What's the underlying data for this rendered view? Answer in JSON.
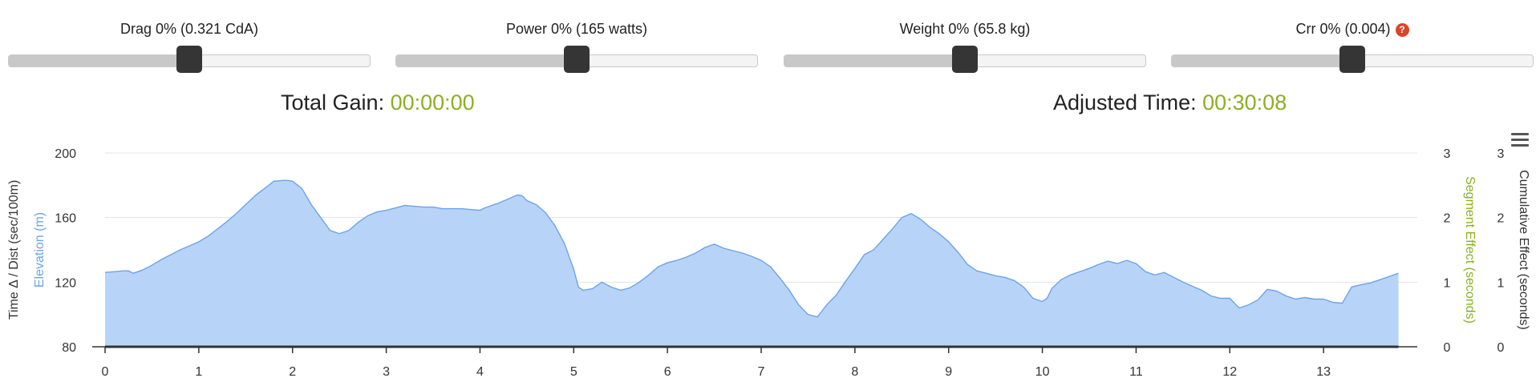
{
  "sliders": [
    {
      "label": "Drag 0% (0.321 CdA)",
      "value_fraction": 0.5,
      "help": false
    },
    {
      "label": "Power 0% (165 watts)",
      "value_fraction": 0.5,
      "help": false
    },
    {
      "label": "Weight 0% (65.8 kg)",
      "value_fraction": 0.5,
      "help": false
    },
    {
      "label": "Crr 0% (0.004)",
      "value_fraction": 0.5,
      "help": true,
      "help_symbol": "?"
    }
  ],
  "summary": {
    "total_gain_label": "Total Gain:",
    "total_gain_value": "00:00:00",
    "adjusted_time_label": "Adjusted Time:",
    "adjusted_time_value": "00:30:08"
  },
  "colors": {
    "elevation_line": "#6ea3e8",
    "elevation_fill": "#b7d4f8",
    "segment_effect": "#8bb021",
    "value_text": "#8bb021",
    "help_icon": "#d9462b",
    "slider_handle": "#353535"
  },
  "chart_data": {
    "type": "area",
    "x": [
      0,
      0.1,
      0.2,
      0.25,
      0.3,
      0.4,
      0.5,
      0.6,
      0.7,
      0.8,
      0.9,
      1.0,
      1.1,
      1.2,
      1.3,
      1.4,
      1.5,
      1.6,
      1.7,
      1.8,
      1.9,
      1.95,
      2.0,
      2.1,
      2.2,
      2.3,
      2.4,
      2.5,
      2.6,
      2.65,
      2.7,
      2.8,
      2.9,
      3.0,
      3.1,
      3.2,
      3.3,
      3.4,
      3.5,
      3.6,
      3.7,
      3.8,
      3.9,
      4.0,
      4.05,
      4.1,
      4.2,
      4.3,
      4.4,
      4.45,
      4.5,
      4.6,
      4.7,
      4.8,
      4.9,
      5.0,
      5.05,
      5.1,
      5.2,
      5.3,
      5.4,
      5.5,
      5.6,
      5.7,
      5.8,
      5.9,
      6.0,
      6.1,
      6.2,
      6.3,
      6.4,
      6.5,
      6.6,
      6.7,
      6.8,
      6.9,
      7.0,
      7.1,
      7.2,
      7.3,
      7.4,
      7.5,
      7.6,
      7.7,
      7.8,
      7.9,
      8.0,
      8.1,
      8.2,
      8.3,
      8.4,
      8.5,
      8.6,
      8.7,
      8.8,
      8.9,
      9.0,
      9.1,
      9.2,
      9.3,
      9.4,
      9.5,
      9.6,
      9.7,
      9.8,
      9.9,
      10.0,
      10.05,
      10.1,
      10.2,
      10.3,
      10.4,
      10.5,
      10.6,
      10.7,
      10.8,
      10.9,
      11.0,
      11.1,
      11.2,
      11.3,
      11.4,
      11.5,
      11.6,
      11.7,
      11.8,
      11.9,
      12.0,
      12.1,
      12.2,
      12.3,
      12.4,
      12.5,
      12.6,
      12.7,
      12.8,
      12.9,
      13.0,
      13.1,
      13.2,
      13.3,
      13.4,
      13.5,
      13.6,
      13.7,
      13.8
    ],
    "series": [
      {
        "name": "Elevation (m)",
        "axis": "left",
        "y": [
          126,
          126.5,
          127,
          127,
          125.5,
          127.5,
          130.5,
          134,
          137,
          140,
          142.5,
          145,
          148.5,
          153,
          157.5,
          162.5,
          168,
          173.5,
          178,
          182.5,
          183,
          183,
          182.5,
          178,
          168,
          160,
          152,
          150,
          152,
          154.5,
          157,
          161,
          163.5,
          164.5,
          166,
          167.5,
          167,
          166.5,
          166.5,
          165.5,
          165.5,
          165.5,
          165,
          164.5,
          166,
          167,
          169,
          171.5,
          174,
          173.5,
          170.5,
          168,
          163,
          155,
          144,
          128,
          117,
          115,
          116,
          120,
          117,
          115,
          116.5,
          120,
          124.5,
          129.5,
          132,
          133.5,
          135.5,
          138,
          141.5,
          143.5,
          141,
          139.5,
          138,
          136,
          133.5,
          129.5,
          122.5,
          115,
          106,
          100,
          98.5,
          106,
          112,
          120.5,
          128.5,
          137,
          140,
          146.5,
          153,
          160,
          162.5,
          159,
          154,
          150,
          145,
          138.5,
          131,
          127,
          125.5,
          124,
          123,
          121,
          117,
          110,
          108,
          110,
          116,
          121.5,
          124.5,
          126.5,
          128.5,
          131,
          133,
          131.5,
          133.5,
          131.5,
          126.5,
          124.5,
          126,
          123,
          120,
          117.5,
          115,
          111.5,
          110,
          110,
          104,
          106,
          109,
          115.5,
          114.5,
          111.5,
          109.5,
          110.5,
          109.5,
          109.5,
          107.5,
          107,
          117,
          118.5,
          119.5,
          121.5,
          123.5,
          125.5
        ]
      }
    ],
    "x_ticks": [
      "0",
      "1",
      "2",
      "3",
      "4",
      "5",
      "6",
      "7",
      "8",
      "9",
      "10",
      "11",
      "12",
      "13"
    ],
    "y_ticks": [
      "80",
      "120",
      "160",
      "200"
    ],
    "y_right_ticks": [
      "0",
      "1",
      "2",
      "3"
    ],
    "y2_right_ticks": [
      "0",
      "1",
      "2",
      "3"
    ],
    "xlim": [
      0,
      14
    ],
    "ylim": [
      80,
      200
    ],
    "y_right_lim": [
      0,
      3
    ],
    "xlabel": "",
    "ylabel_primary": "Time Δ / Dist (sec/100m)",
    "ylabel_secondary": "Elevation (m)",
    "ylabel_right": "Segment Effect (seconds)",
    "ylabel_right2": "Cumulative Effect (seconds)",
    "grid": true
  }
}
